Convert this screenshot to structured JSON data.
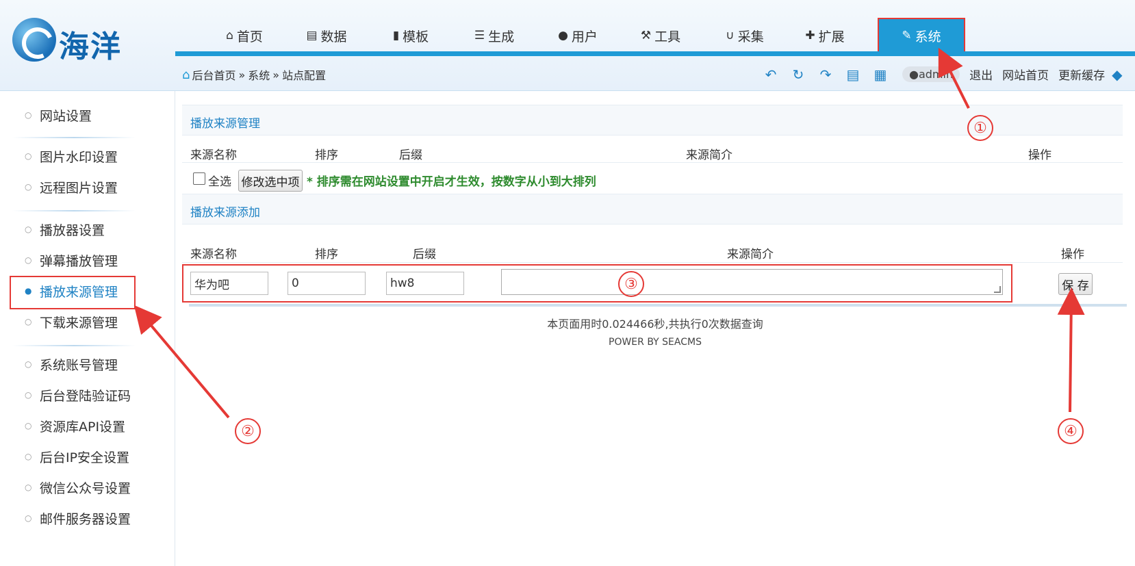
{
  "logo": {
    "text": "海洋"
  },
  "nav": [
    {
      "icon": "home-icon",
      "glyph": "⌂",
      "label": "首页"
    },
    {
      "icon": "book-icon",
      "glyph": "▤",
      "label": "数据"
    },
    {
      "icon": "file-icon",
      "glyph": "▮",
      "label": "模板"
    },
    {
      "icon": "list-icon",
      "glyph": "☰",
      "label": "生成"
    },
    {
      "icon": "user-icon",
      "glyph": "●",
      "label": "用户"
    },
    {
      "icon": "wrench-icon",
      "glyph": "⚒",
      "label": "工具"
    },
    {
      "icon": "magnet-icon",
      "glyph": "∪",
      "label": "采集"
    },
    {
      "icon": "puzzle-icon",
      "glyph": "✚",
      "label": "扩展"
    },
    {
      "icon": "edit-icon",
      "glyph": "✎",
      "label": "系统",
      "active": true
    }
  ],
  "breadcrumb": {
    "home": "后台首页",
    "sep": "»",
    "level1": "系统",
    "level2": "站点配置"
  },
  "toolbar": {
    "user": "admin",
    "logout": "退出",
    "site_home": "网站首页",
    "refresh_cache": "更新缓存"
  },
  "sidebar": [
    {
      "label": "网站设置"
    },
    {
      "label": "图片水印设置"
    },
    {
      "label": "远程图片设置"
    },
    {
      "label": "播放器设置"
    },
    {
      "label": "弹幕播放管理"
    },
    {
      "label": "播放来源管理",
      "active": true
    },
    {
      "label": "下载来源管理"
    },
    {
      "label": "系统账号管理"
    },
    {
      "label": "后台登陆验证码"
    },
    {
      "label": "资源库API设置"
    },
    {
      "label": "后台IP安全设置"
    },
    {
      "label": "微信公众号设置"
    },
    {
      "label": "邮件服务器设置"
    }
  ],
  "manage": {
    "title": "播放来源管理",
    "headers": {
      "name": "来源名称",
      "order": "排序",
      "suffix": "后缀",
      "intro": "来源简介",
      "action": "操作"
    },
    "select_all": "全选",
    "modify_button": "修改选中项",
    "hint": "* 排序需在网站设置中开启才生效，按数字从小到大排列"
  },
  "add": {
    "title": "播放来源添加",
    "headers": {
      "name": "来源名称",
      "order": "排序",
      "suffix": "后缀",
      "intro": "来源简介",
      "action": "操作"
    },
    "name_value": "华为吧",
    "order_value": "0",
    "suffix_value": "hw8",
    "intro_value": "",
    "save_button": "保 存"
  },
  "footer": {
    "timing": "本页面用时0.024466秒,共执行0次数据查询",
    "power": "POWER BY SEACMS"
  },
  "annotations": [
    "①",
    "②",
    "③",
    "④"
  ],
  "colors": {
    "accent": "#1f9bd6",
    "annotation": "#e53935",
    "hint": "#2e8b2e"
  }
}
